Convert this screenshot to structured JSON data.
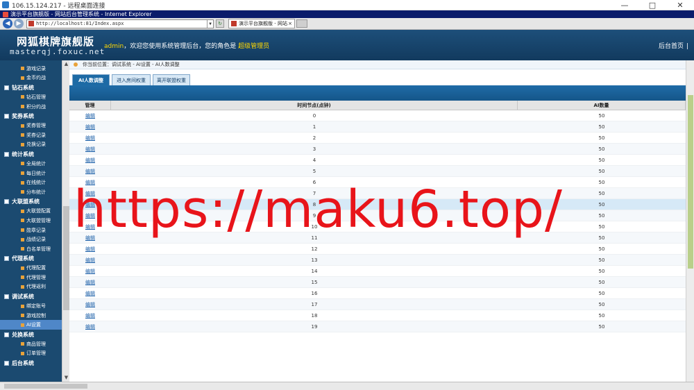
{
  "remote_desktop": {
    "title": "106.15.124.217 - 远程桌面连接",
    "controls": [
      "—",
      "□",
      "✕"
    ]
  },
  "browser": {
    "window_title": "演示平台旗舰版 - 网站后台管理系统 - Internet Explorer",
    "address": "http://localhost:81/Index.aspx",
    "tab_label": "演示平台旗舰版 - 网站...",
    "tab_close": "×"
  },
  "header": {
    "logo_cn": "网狐棋牌旗舰版",
    "logo_en": "masterqj.foxuc.net",
    "welcome_user": "admin",
    "welcome_text": "，欢迎您使用系统管理后台，您的角色是",
    "role": "超级管理员",
    "right_link": "后台首页",
    "right_sep": "|"
  },
  "sidebar": {
    "sections": [
      {
        "type": "item",
        "label": "游戏记录"
      },
      {
        "type": "item",
        "label": "金币约战"
      },
      {
        "type": "group",
        "label": "钻石系统"
      },
      {
        "type": "item",
        "label": "钻石管理"
      },
      {
        "type": "item",
        "label": "积分约战"
      },
      {
        "type": "group",
        "label": "奖券系统"
      },
      {
        "type": "item",
        "label": "奖券管理"
      },
      {
        "type": "item",
        "label": "奖券记录"
      },
      {
        "type": "item",
        "label": "兑换记录"
      },
      {
        "type": "group",
        "label": "统计系统"
      },
      {
        "type": "item",
        "label": "全局统计"
      },
      {
        "type": "item",
        "label": "每日统计"
      },
      {
        "type": "item",
        "label": "在线统计"
      },
      {
        "type": "item",
        "label": "分布统计"
      },
      {
        "type": "group",
        "label": "大联盟系统"
      },
      {
        "type": "item",
        "label": "大联盟配置"
      },
      {
        "type": "item",
        "label": "大联盟管理"
      },
      {
        "type": "item",
        "label": "勋章记录"
      },
      {
        "type": "item",
        "label": "战绩记录"
      },
      {
        "type": "item",
        "label": "白名单管理"
      },
      {
        "type": "group",
        "label": "代理系统"
      },
      {
        "type": "item",
        "label": "代理配置"
      },
      {
        "type": "item",
        "label": "代理管理"
      },
      {
        "type": "item",
        "label": "代理返利"
      },
      {
        "type": "group",
        "label": "调试系统"
      },
      {
        "type": "item",
        "label": "绑定账号"
      },
      {
        "type": "item",
        "label": "游戏控制"
      },
      {
        "type": "item",
        "label": "AI设置",
        "active": true
      },
      {
        "type": "group",
        "label": "兑换系统"
      },
      {
        "type": "item",
        "label": "商品管理"
      },
      {
        "type": "item",
        "label": "订单管理"
      },
      {
        "type": "group",
        "label": "后台系统"
      }
    ]
  },
  "main": {
    "breadcrumb": "你当前位置：调试系统 - AI设置 - AI人数调整",
    "tabs": [
      {
        "label": "AI人数调整",
        "active": true
      },
      {
        "label": "进入房间权重",
        "active": false
      },
      {
        "label": "离开联盟权重",
        "active": false
      }
    ],
    "table": {
      "headers": [
        "管理",
        "时间节点(点钟)",
        "AI数量"
      ],
      "rows": [
        {
          "action": "编辑",
          "hour": "0",
          "count": "50"
        },
        {
          "action": "编辑",
          "hour": "1",
          "count": "50"
        },
        {
          "action": "编辑",
          "hour": "2",
          "count": "50"
        },
        {
          "action": "编辑",
          "hour": "3",
          "count": "50"
        },
        {
          "action": "编辑",
          "hour": "4",
          "count": "50"
        },
        {
          "action": "编辑",
          "hour": "5",
          "count": "50"
        },
        {
          "action": "编辑",
          "hour": "6",
          "count": "50"
        },
        {
          "action": "编辑",
          "hour": "7",
          "count": "50"
        },
        {
          "action": "编辑",
          "hour": "8",
          "count": "50"
        },
        {
          "action": "编辑",
          "hour": "9",
          "count": "50"
        },
        {
          "action": "编辑",
          "hour": "10",
          "count": "50"
        },
        {
          "action": "编辑",
          "hour": "11",
          "count": "50"
        },
        {
          "action": "编辑",
          "hour": "12",
          "count": "50"
        },
        {
          "action": "编辑",
          "hour": "13",
          "count": "50"
        },
        {
          "action": "编辑",
          "hour": "14",
          "count": "50"
        },
        {
          "action": "编辑",
          "hour": "15",
          "count": "50"
        },
        {
          "action": "编辑",
          "hour": "16",
          "count": "50"
        },
        {
          "action": "编辑",
          "hour": "17",
          "count": "50"
        },
        {
          "action": "编辑",
          "hour": "18",
          "count": "50"
        },
        {
          "action": "编辑",
          "hour": "19",
          "count": "50"
        }
      ]
    }
  },
  "watermark": "https://maku6.top/",
  "colors": {
    "header_bg": "#1d4f7a",
    "sidebar_bg": "#1b4a70",
    "accent_blue": "#1d6aa5",
    "highlight_yellow": "#ffd800",
    "watermark_red": "#e8141a"
  }
}
